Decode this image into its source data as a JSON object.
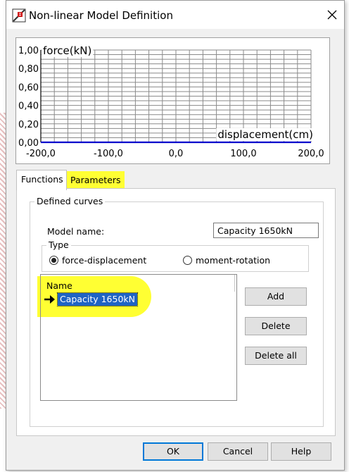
{
  "dialog": {
    "title": "Non-linear Model Definition",
    "icons": {
      "app": "app-logo-icon",
      "close": "close-icon"
    }
  },
  "chart_data": {
    "type": "line",
    "title": "",
    "ylabel": "force(kN)",
    "xlabel": "displacement(cm)",
    "xlim": [
      -200,
      200
    ],
    "ylim": [
      0,
      1
    ],
    "x_ticks": [
      "-200,0",
      "-100,0",
      "0,0",
      "100,0",
      "200,0"
    ],
    "y_ticks": [
      "1,00",
      "0,80",
      "0,60",
      "0,40",
      "0,20",
      "0,00"
    ],
    "grid": true,
    "series": [
      {
        "x": [
          -200,
          200
        ],
        "y": [
          0,
          0
        ],
        "color": "#0000cc"
      }
    ]
  },
  "tabs": {
    "functions": "Functions",
    "parameters": "Parameters"
  },
  "defined_curves": {
    "legend": "Defined curves",
    "model_name_label": "Model name:",
    "model_name_value": "Capacity 1650kN",
    "type": {
      "legend": "Type",
      "option1": "force-displacement",
      "option2": "moment-rotation",
      "selected": "force-displacement"
    },
    "list": {
      "header": "Name",
      "items": [
        "Capacity 1650kN"
      ],
      "selected_icon": "arrow-right-icon"
    }
  },
  "buttons": {
    "add": "Add",
    "delete": "Delete",
    "delete_all": "Delete all",
    "ok": "OK",
    "cancel": "Cancel",
    "help": "Help"
  },
  "colors": {
    "highlight": "#ffff33",
    "selection": "#1f63c4",
    "curve": "#0000cc",
    "focus": "#0078d7"
  }
}
